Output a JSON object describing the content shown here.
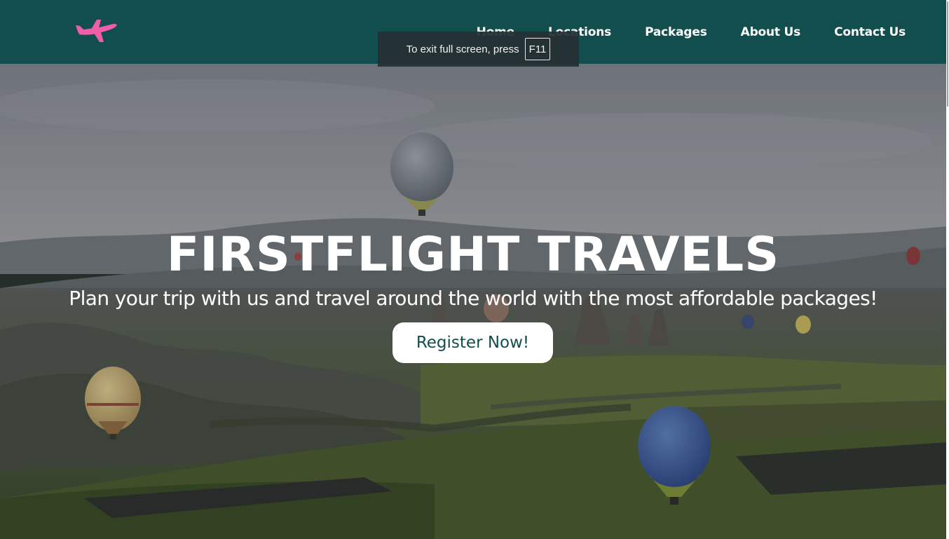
{
  "nav": {
    "logo": "airplane-icon",
    "links": [
      "Home",
      "Locations",
      "Packages",
      "About Us",
      "Contact Us"
    ]
  },
  "fullscreen_notice": {
    "text": "To exit full screen, press",
    "key": "F11"
  },
  "hero": {
    "title": "FIRSTFLIGHT TRAVELS",
    "subtitle": "Plan your trip with us and travel around the world with the most affordable packages!",
    "button_label": "Register Now!"
  },
  "colors": {
    "navbar": "#134e4f",
    "logo": "#ef5ea8",
    "button_text": "#134e4f",
    "button_bg": "#ffffff",
    "hero_text": "#ffffff"
  }
}
